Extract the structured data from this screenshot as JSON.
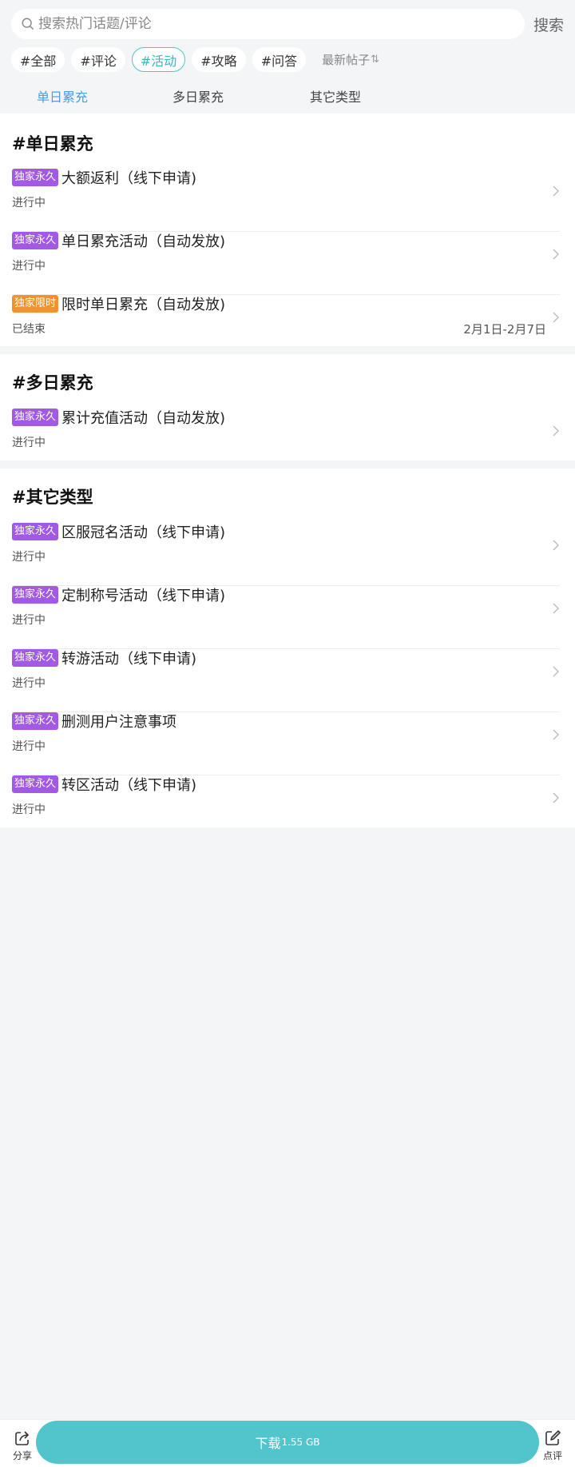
{
  "search": {
    "placeholder": "搜索热门话题/评论",
    "button_label": "搜索"
  },
  "chips": [
    {
      "label": "#全部",
      "active": false
    },
    {
      "label": "#评论",
      "active": false
    },
    {
      "label": "#活动",
      "active": true
    },
    {
      "label": "#攻略",
      "active": false
    },
    {
      "label": "#问答",
      "active": false
    }
  ],
  "sort": {
    "label": "最新帖子",
    "icon": "sort-icon"
  },
  "tabs": [
    {
      "label": "单日累充",
      "active": true
    },
    {
      "label": "多日累充",
      "active": false
    },
    {
      "label": "其它类型",
      "active": false
    }
  ],
  "sections": [
    {
      "title": "#单日累充",
      "items": [
        {
          "badge": "独家永久",
          "badge_color": "#a259e4",
          "title": "大额返利（线下申请)",
          "status": "进行中",
          "date": ""
        },
        {
          "badge": "独家永久",
          "badge_color": "#a259e4",
          "title": "单日累充活动（自动发放)",
          "status": "进行中",
          "date": ""
        },
        {
          "badge": "独家限时",
          "badge_color": "#f0922d",
          "title": "限时单日累充（自动发放)",
          "status": "已结束",
          "date": "2月1日-2月7日"
        }
      ]
    },
    {
      "title": "#多日累充",
      "items": [
        {
          "badge": "独家永久",
          "badge_color": "#a259e4",
          "title": "累计充值活动（自动发放)",
          "status": "进行中",
          "date": ""
        }
      ]
    },
    {
      "title": "#其它类型",
      "items": [
        {
          "badge": "独家永久",
          "badge_color": "#a259e4",
          "title": "区服冠名活动（线下申请)",
          "status": "进行中",
          "date": ""
        },
        {
          "badge": "独家永久",
          "badge_color": "#a259e4",
          "title": "定制称号活动（线下申请)",
          "status": "进行中",
          "date": ""
        },
        {
          "badge": "独家永久",
          "badge_color": "#a259e4",
          "title": "转游活动（线下申请)",
          "status": "进行中",
          "date": ""
        },
        {
          "badge": "独家永久",
          "badge_color": "#a259e4",
          "title": "删测用户注意事项",
          "status": "进行中",
          "date": ""
        },
        {
          "badge": "独家永久",
          "badge_color": "#a259e4",
          "title": "转区活动（线下申请)",
          "status": "进行中",
          "date": ""
        }
      ]
    }
  ],
  "bottom_bar": {
    "share_label": "分享",
    "download_label": "下载",
    "download_size": "1.55 GB",
    "review_label": "点评"
  },
  "colors": {
    "accent": "#52c5cc",
    "tab_active": "#4a9be8",
    "badge_purple": "#a259e4",
    "badge_orange": "#f0922d"
  }
}
